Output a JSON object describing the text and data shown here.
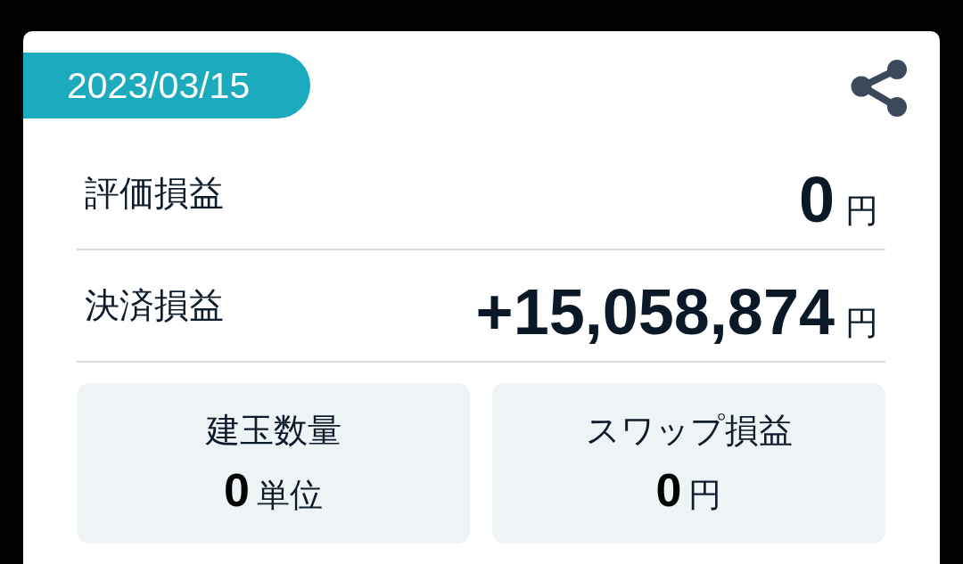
{
  "date_tag": {
    "label": "2023/03/15"
  },
  "rows": [
    {
      "label": "評価損益",
      "value": "0",
      "unit": "円"
    },
    {
      "label": "決済損益",
      "value": "+15,058,874",
      "unit": "円"
    }
  ],
  "summary_tiles": [
    {
      "label": "建玉数量",
      "value": "0",
      "unit": "単位"
    },
    {
      "label": "スワップ損益",
      "value": "0",
      "unit": "円"
    }
  ]
}
